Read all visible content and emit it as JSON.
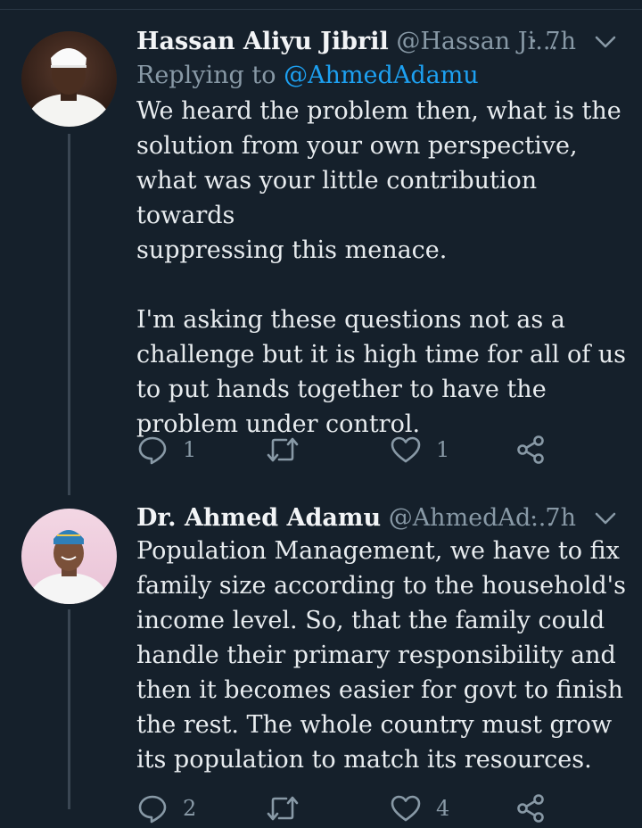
{
  "tweets": [
    {
      "name": "Hassan Aliyu  Jibril",
      "handle": "@Hassan Ji...",
      "time": "· 7h",
      "replying_prefix": "Replying to ",
      "replying_to": "@AhmedAdamu",
      "paragraphs": [
        [
          "We heard the problem then, what is the",
          "solution from your own perspective,",
          "what was your little contribution towards",
          "suppressing this menace."
        ],
        [
          "I'm asking these questions not as a",
          "challenge but it is high time for all of us",
          "to put hands together to have the",
          "problem under control."
        ]
      ],
      "reply_count": "1",
      "retweet_count": "",
      "like_count": "1"
    },
    {
      "name": "Dr. Ahmed Adamu",
      "handle": "@AhmedAd...",
      "time": "· 7h",
      "paragraphs": [
        [
          "Population Management, we have to fix",
          "family size according to the household's",
          "income level. So, that the family could",
          "handle their primary responsibility and",
          "then it becomes easier for govt to finish",
          "the rest. The whole country must grow",
          "its population to match its resources."
        ]
      ],
      "reply_count": "2",
      "retweet_count": "",
      "like_count": "4"
    }
  ],
  "icons": [
    "reply-icon",
    "retweet-icon",
    "like-icon",
    "share-icon",
    "chevron-down-icon"
  ],
  "colors": {
    "background": "#15202b",
    "link": "#1da1f2",
    "muted": "#8899a6",
    "text": "#e8ecef"
  }
}
